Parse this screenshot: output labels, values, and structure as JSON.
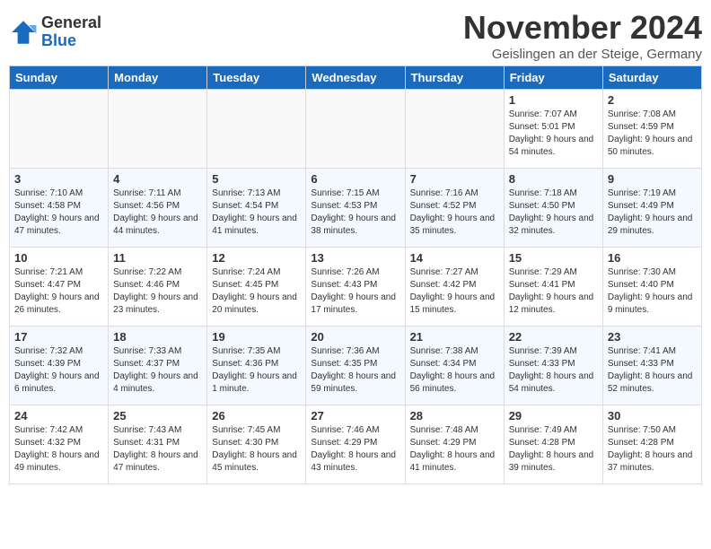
{
  "logo": {
    "general": "General",
    "blue": "Blue"
  },
  "title": "November 2024",
  "location": "Geislingen an der Steige, Germany",
  "headers": [
    "Sunday",
    "Monday",
    "Tuesday",
    "Wednesday",
    "Thursday",
    "Friday",
    "Saturday"
  ],
  "weeks": [
    [
      {
        "day": "",
        "detail": ""
      },
      {
        "day": "",
        "detail": ""
      },
      {
        "day": "",
        "detail": ""
      },
      {
        "day": "",
        "detail": ""
      },
      {
        "day": "",
        "detail": ""
      },
      {
        "day": "1",
        "detail": "Sunrise: 7:07 AM\nSunset: 5:01 PM\nDaylight: 9 hours and 54 minutes."
      },
      {
        "day": "2",
        "detail": "Sunrise: 7:08 AM\nSunset: 4:59 PM\nDaylight: 9 hours and 50 minutes."
      }
    ],
    [
      {
        "day": "3",
        "detail": "Sunrise: 7:10 AM\nSunset: 4:58 PM\nDaylight: 9 hours and 47 minutes."
      },
      {
        "day": "4",
        "detail": "Sunrise: 7:11 AM\nSunset: 4:56 PM\nDaylight: 9 hours and 44 minutes."
      },
      {
        "day": "5",
        "detail": "Sunrise: 7:13 AM\nSunset: 4:54 PM\nDaylight: 9 hours and 41 minutes."
      },
      {
        "day": "6",
        "detail": "Sunrise: 7:15 AM\nSunset: 4:53 PM\nDaylight: 9 hours and 38 minutes."
      },
      {
        "day": "7",
        "detail": "Sunrise: 7:16 AM\nSunset: 4:52 PM\nDaylight: 9 hours and 35 minutes."
      },
      {
        "day": "8",
        "detail": "Sunrise: 7:18 AM\nSunset: 4:50 PM\nDaylight: 9 hours and 32 minutes."
      },
      {
        "day": "9",
        "detail": "Sunrise: 7:19 AM\nSunset: 4:49 PM\nDaylight: 9 hours and 29 minutes."
      }
    ],
    [
      {
        "day": "10",
        "detail": "Sunrise: 7:21 AM\nSunset: 4:47 PM\nDaylight: 9 hours and 26 minutes."
      },
      {
        "day": "11",
        "detail": "Sunrise: 7:22 AM\nSunset: 4:46 PM\nDaylight: 9 hours and 23 minutes."
      },
      {
        "day": "12",
        "detail": "Sunrise: 7:24 AM\nSunset: 4:45 PM\nDaylight: 9 hours and 20 minutes."
      },
      {
        "day": "13",
        "detail": "Sunrise: 7:26 AM\nSunset: 4:43 PM\nDaylight: 9 hours and 17 minutes."
      },
      {
        "day": "14",
        "detail": "Sunrise: 7:27 AM\nSunset: 4:42 PM\nDaylight: 9 hours and 15 minutes."
      },
      {
        "day": "15",
        "detail": "Sunrise: 7:29 AM\nSunset: 4:41 PM\nDaylight: 9 hours and 12 minutes."
      },
      {
        "day": "16",
        "detail": "Sunrise: 7:30 AM\nSunset: 4:40 PM\nDaylight: 9 hours and 9 minutes."
      }
    ],
    [
      {
        "day": "17",
        "detail": "Sunrise: 7:32 AM\nSunset: 4:39 PM\nDaylight: 9 hours and 6 minutes."
      },
      {
        "day": "18",
        "detail": "Sunrise: 7:33 AM\nSunset: 4:37 PM\nDaylight: 9 hours and 4 minutes."
      },
      {
        "day": "19",
        "detail": "Sunrise: 7:35 AM\nSunset: 4:36 PM\nDaylight: 9 hours and 1 minute."
      },
      {
        "day": "20",
        "detail": "Sunrise: 7:36 AM\nSunset: 4:35 PM\nDaylight: 8 hours and 59 minutes."
      },
      {
        "day": "21",
        "detail": "Sunrise: 7:38 AM\nSunset: 4:34 PM\nDaylight: 8 hours and 56 minutes."
      },
      {
        "day": "22",
        "detail": "Sunrise: 7:39 AM\nSunset: 4:33 PM\nDaylight: 8 hours and 54 minutes."
      },
      {
        "day": "23",
        "detail": "Sunrise: 7:41 AM\nSunset: 4:33 PM\nDaylight: 8 hours and 52 minutes."
      }
    ],
    [
      {
        "day": "24",
        "detail": "Sunrise: 7:42 AM\nSunset: 4:32 PM\nDaylight: 8 hours and 49 minutes."
      },
      {
        "day": "25",
        "detail": "Sunrise: 7:43 AM\nSunset: 4:31 PM\nDaylight: 8 hours and 47 minutes."
      },
      {
        "day": "26",
        "detail": "Sunrise: 7:45 AM\nSunset: 4:30 PM\nDaylight: 8 hours and 45 minutes."
      },
      {
        "day": "27",
        "detail": "Sunrise: 7:46 AM\nSunset: 4:29 PM\nDaylight: 8 hours and 43 minutes."
      },
      {
        "day": "28",
        "detail": "Sunrise: 7:48 AM\nSunset: 4:29 PM\nDaylight: 8 hours and 41 minutes."
      },
      {
        "day": "29",
        "detail": "Sunrise: 7:49 AM\nSunset: 4:28 PM\nDaylight: 8 hours and 39 minutes."
      },
      {
        "day": "30",
        "detail": "Sunrise: 7:50 AM\nSunset: 4:28 PM\nDaylight: 8 hours and 37 minutes."
      }
    ]
  ]
}
